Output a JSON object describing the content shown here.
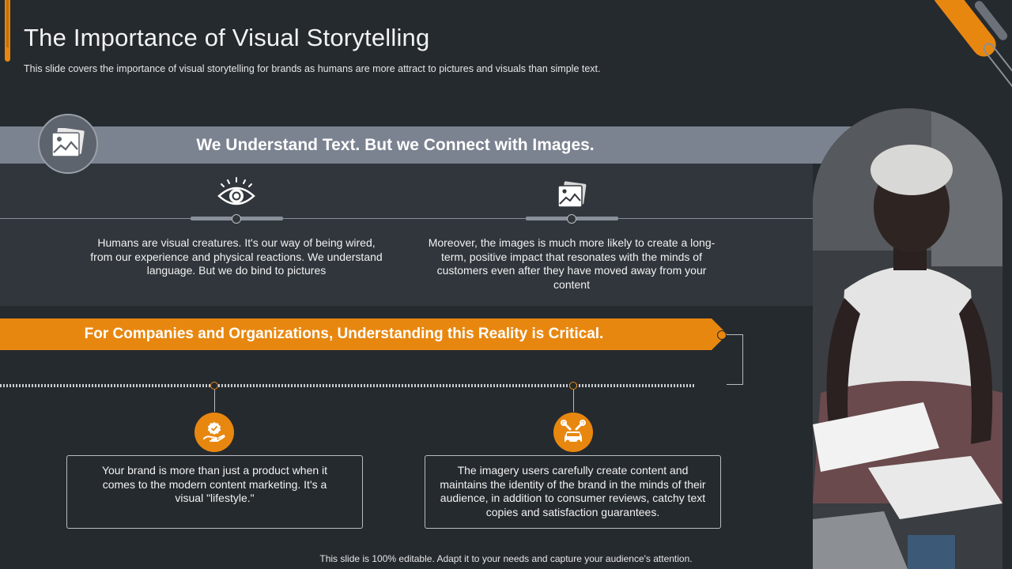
{
  "header": {
    "title": "The Importance of Visual Storytelling",
    "subtitle": "This slide covers the importance of visual storytelling for brands as humans are more attract to pictures and visuals than simple text."
  },
  "banner_top": {
    "text": "We Understand Text. But we Connect with Images.",
    "icon": "image-icon"
  },
  "upper_points": [
    {
      "icon": "eye-icon",
      "text": "Humans are visual creatures. It's our way of being wired, from our experience and physical reactions. We understand language.  But we do bind to pictures"
    },
    {
      "icon": "image-icon",
      "text": "Moreover,  the images is much more likely  to create a long-term, positive impact that resonates with the minds of customers even after they have moved away from your content"
    }
  ],
  "banner_orange": {
    "text": "For Companies and Organizations, Understanding this Reality is Critical."
  },
  "lower_points": [
    {
      "icon": "hand-badge-icon",
      "text": "Your brand is more than just a product when it comes to the modern content marketing. It's a visual \"lifestyle.\""
    },
    {
      "icon": "car-repair-icon",
      "text": "The imagery users carefully create content and maintains the identity of the brand in the minds of their audience, in addition to consumer reviews, catchy text copies and satisfaction guarantees."
    }
  ],
  "footer": {
    "text": "This slide is 100% editable. Adapt it to your needs and capture your audience's attention."
  },
  "colors": {
    "background": "#252a2f",
    "accent": "#e8870f",
    "banner_gray": "#7b8290",
    "panel": "#30363c"
  }
}
